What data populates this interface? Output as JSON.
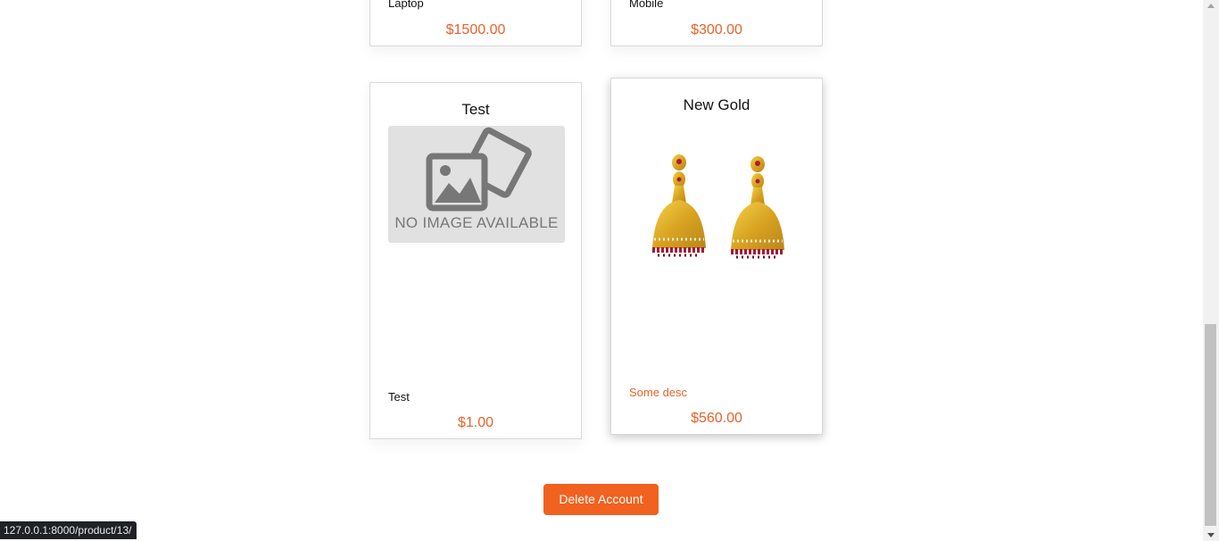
{
  "products": [
    {
      "id": "laptop",
      "title": "",
      "description": "Laptop",
      "price": "$1500.00"
    },
    {
      "id": "mobile",
      "title": "",
      "description": "Mobile",
      "price": "$300.00"
    },
    {
      "id": "test",
      "title": "Test",
      "description": "Test",
      "price": "$1.00",
      "image_text": "NO IMAGE AVAILABLE"
    },
    {
      "id": "gold",
      "title": "New Gold",
      "description": "Some desc",
      "price": "$560.00"
    }
  ],
  "actions": {
    "delete_account_label": "Delete Account"
  },
  "status_bar": {
    "url": "127.0.0.1:8000/product/13/"
  },
  "colors": {
    "accent": "#f1611f",
    "price": "#e8622c"
  }
}
